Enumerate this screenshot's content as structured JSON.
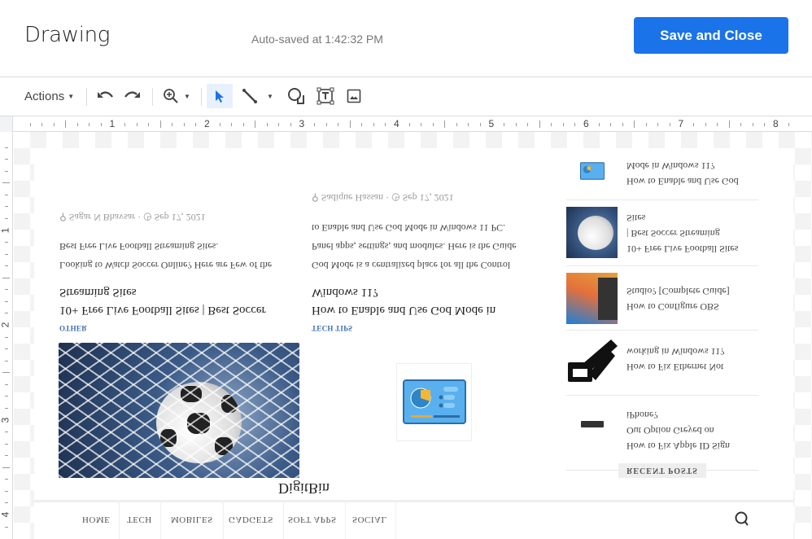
{
  "header": {
    "title": "Drawing",
    "autosave": "Auto-saved at 1:42:32 PM",
    "save_close": "Save and Close"
  },
  "toolbar": {
    "actions": "Actions",
    "tools": [
      "undo-icon",
      "redo-icon",
      "zoom-icon",
      "select-icon",
      "line-icon",
      "shape-icon",
      "textbox-icon",
      "image-icon"
    ]
  },
  "ruler": {
    "horizontal": [
      "1",
      "2",
      "3",
      "4",
      "5",
      "6",
      "7",
      "8"
    ],
    "vertical": [
      "1",
      "2",
      "3",
      "4"
    ]
  },
  "canvas_image": {
    "orientation": "flipped-vertical",
    "site": {
      "logo": "DigitBin",
      "nav": [
        "HOME",
        "TECH",
        "MOBILES",
        "GADGETS",
        "SOFT APPS",
        "SOCIAL"
      ],
      "posts": [
        {
          "category": "OTHER",
          "title_lines": [
            "10+ Free Live Football Sites | Best Soccer",
            "Streaming Sites"
          ],
          "excerpt_lines": [
            "Looking to Watch Soccer Online? Here are Few of the",
            "Best Free Live Football Streaming Sites."
          ],
          "author": "Sagar N Bhavsar",
          "date": "Sep 17, 2021"
        },
        {
          "category": "TECH TIPS",
          "title_lines": [
            "How to Enable and Use God Mode in",
            "Windows 11?"
          ],
          "excerpt_lines": [
            "God Mode is a centralized place for all the Control",
            "Panel apps, settings, and modules. Here is the Guide",
            "to Enable and Use God Mode in Windows 11 PC."
          ],
          "author": "Sadique Hassan",
          "date": "Sep 17, 2021"
        }
      ],
      "recent_posts_label": "RECENT POSTS",
      "recent_posts": [
        {
          "title_lines": [
            "How to Fix Apple ID Sign",
            "Out Option Greyed on",
            "iPhone?"
          ]
        },
        {
          "title_lines": [
            "How to Fix Ethernet Not",
            "working in Windows 11?"
          ]
        },
        {
          "title_lines": [
            "How to Configure OBS",
            "Studio? [Complete Guide]"
          ]
        },
        {
          "title_lines": [
            "10+ Free Live Football Sites",
            "| Best Soccer Streaming",
            "Sites"
          ]
        },
        {
          "title_lines": [
            "How to Enable and Use God",
            "Mode in Windows 11?"
          ]
        }
      ]
    }
  }
}
